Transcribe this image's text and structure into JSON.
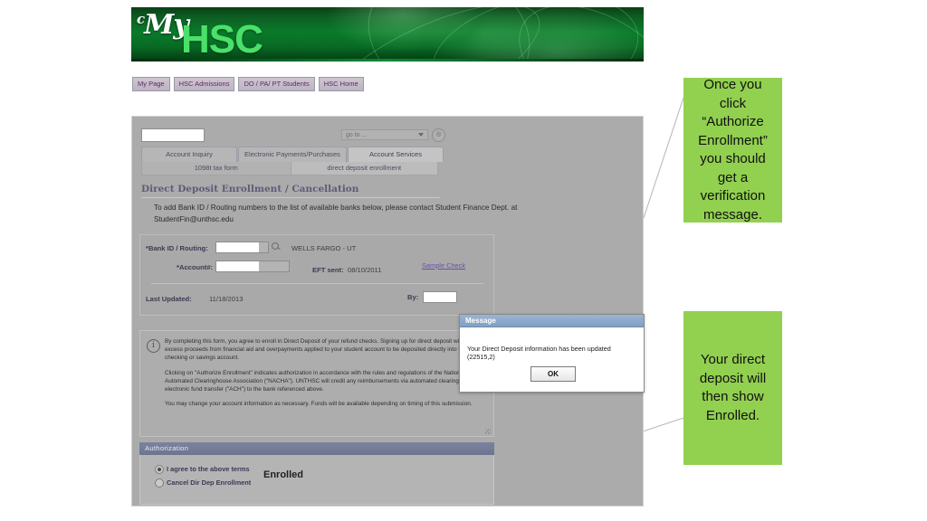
{
  "site": {
    "logo_my": "My",
    "logo_hsc": "HSC",
    "top_nav": [
      {
        "label": "My Page"
      },
      {
        "label": "HSC Admissions"
      },
      {
        "label": "DO / PA/ PT Students"
      },
      {
        "label": "HSC Home"
      }
    ]
  },
  "app": {
    "search_value": "",
    "goto_placeholder": "go to ...",
    "goto_button_icon": "target-icon",
    "tabs_primary": [
      {
        "label": "Account Inquiry",
        "selected": false
      },
      {
        "label": "Electronic Payments/Purchases",
        "selected": false
      },
      {
        "label": "Account Services",
        "selected": true
      }
    ],
    "tabs_secondary": [
      {
        "label": "1098t tax form",
        "selected": false
      },
      {
        "label": "direct deposit enrollment",
        "selected": true
      }
    ]
  },
  "form": {
    "title": "Direct Deposit Enrollment / Cancellation",
    "note": "To add Bank ID / Routing numbers to the list of available banks below, please contact Student Finance Dept. at StudentFin@unthsc.edu",
    "bank_id_label": "*Bank ID / Routing:",
    "bank_id_value": "",
    "bank_lookup_icon": "magnifier-icon",
    "bank_name": "WELLS FARGO - UT",
    "account_label": "*Account#:",
    "account_value": "",
    "eft_label": "EFT sent:",
    "eft_value": "08/10/2011",
    "sample_check_link": "Sample Check",
    "last_updated_label": "Last Updated:",
    "last_updated_value": "11/18/2013",
    "by_label": "By:",
    "by_value": ""
  },
  "disclaimer": {
    "icon": "info-icon",
    "paragraph1": "By completing this form, you agree to enroll in Direct Deposit of your refund checks. Signing up for direct deposit will allow excess proceeds from financial aid and overpayments applied to your student account to be deposited directly into your checking or savings account.",
    "paragraph2": "Clicking on \"Authorize Enrollment\" indicates authorization in accordance with the rules and regulations of the National Automated Clearinghouse Association (\"NACHA\").  UNTHSC will credit any reimbursements via automated clearinghouse electronic fund transfer (\"ACH\") to the bank referenced above.",
    "paragraph3": "You may change your account information as necessary. Funds will be available depending on timing of this submission."
  },
  "authorization": {
    "section_title": "Authorization",
    "option_agree": "I agree to the above terms",
    "option_cancel": "Cancel Dir Dep Enrollment",
    "selected": "agree",
    "status": "Enrolled"
  },
  "dialog": {
    "title": "Message",
    "body": "Your Direct Deposit information has been updated (22515,2)",
    "ok_label": "OK"
  },
  "callouts": [
    {
      "text": "Once you click “Authorize Enrollment” you should get a verification message."
    },
    {
      "text": "Your direct deposit will then show Enrolled."
    }
  ],
  "colors": {
    "callout_green": "#92d050",
    "banner_green": "#0a7a2a",
    "logo_green": "#4ae06a",
    "dialog_title_blue": "#7fa0c4",
    "auth_bar_slate": "#6d758f",
    "link_purple": "#6a4fa0"
  }
}
